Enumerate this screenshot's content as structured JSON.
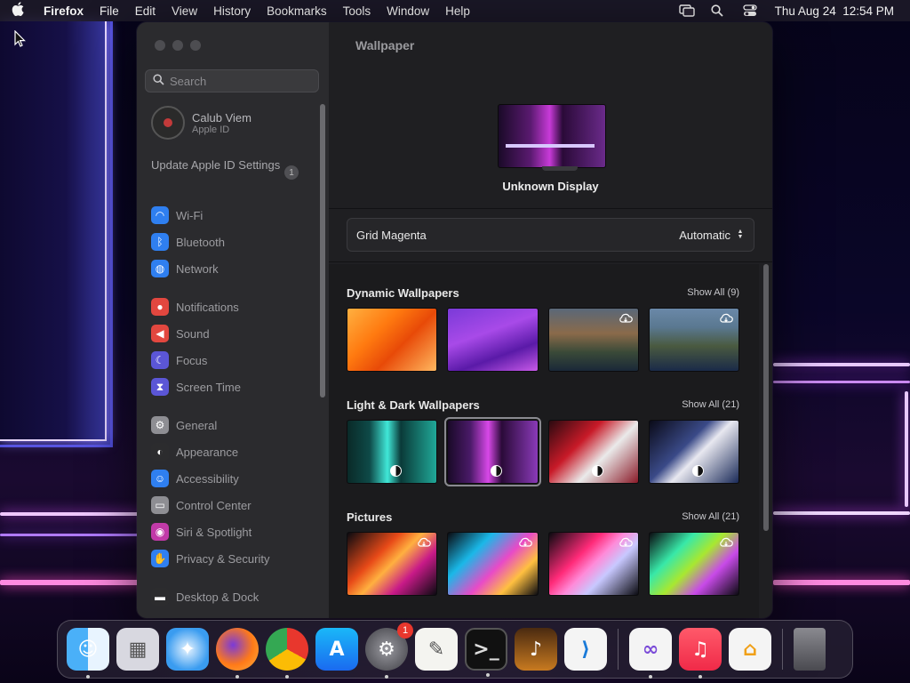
{
  "menubar": {
    "app": "Firefox",
    "items": [
      "File",
      "Edit",
      "View",
      "History",
      "Bookmarks",
      "Tools",
      "Window",
      "Help"
    ],
    "clock": "Thu Aug 24  12:54 PM"
  },
  "window": {
    "sidebar": {
      "search_placeholder": "Search",
      "profile": {
        "name": "Calub Viem",
        "sub": "Apple ID"
      },
      "update": {
        "label": "Update Apple ID Settings",
        "count": "1"
      },
      "items": [
        {
          "label": "Wi-Fi",
          "icon": "wifi-icon",
          "color": "#2f7ff0"
        },
        {
          "label": "Bluetooth",
          "icon": "bluetooth-icon",
          "color": "#2f7ff0"
        },
        {
          "label": "Network",
          "icon": "globe-icon",
          "color": "#2f7ff0"
        },
        {
          "label": "Notifications",
          "icon": "bell-icon",
          "color": "#e2473f"
        },
        {
          "label": "Sound",
          "icon": "speaker-icon",
          "color": "#e2473f"
        },
        {
          "label": "Focus",
          "icon": "moon-icon",
          "color": "#5b56d6"
        },
        {
          "label": "Screen Time",
          "icon": "hourglass-icon",
          "color": "#5b56d6"
        },
        {
          "label": "General",
          "icon": "gear-icon",
          "color": "#8e8e93"
        },
        {
          "label": "Appearance",
          "icon": "appearance-icon",
          "color": "#2c2c2e"
        },
        {
          "label": "Accessibility",
          "icon": "accessibility-icon",
          "color": "#2f7ff0"
        },
        {
          "label": "Control Center",
          "icon": "control-center-icon",
          "color": "#8e8e93"
        },
        {
          "label": "Siri & Spotlight",
          "icon": "siri-icon",
          "color": "#c13aa8"
        },
        {
          "label": "Privacy & Security",
          "icon": "hand-icon",
          "color": "#2f7ff0"
        },
        {
          "label": "Desktop & Dock",
          "icon": "dock-icon",
          "color": "#2c2c2e"
        }
      ]
    },
    "main": {
      "title": "Wallpaper",
      "display_name": "Unknown Display",
      "current_wallpaper": "Grid Magenta",
      "mode": "Automatic",
      "sections": [
        {
          "title": "Dynamic Wallpapers",
          "show_all": "Show All (9)"
        },
        {
          "title": "Light & Dark Wallpapers",
          "show_all": "Show All (21)"
        },
        {
          "title": "Pictures",
          "show_all": "Show All (21)"
        }
      ]
    }
  },
  "dock": {
    "apps": [
      {
        "name": "Finder",
        "icon": "finder-icon",
        "running": true
      },
      {
        "name": "Launchpad",
        "icon": "launchpad-icon",
        "running": false
      },
      {
        "name": "Safari",
        "icon": "safari-icon",
        "running": false
      },
      {
        "name": "Firefox",
        "icon": "firefox-icon",
        "running": true
      },
      {
        "name": "Chrome",
        "icon": "chrome-icon",
        "running": true
      },
      {
        "name": "App Store",
        "icon": "app-store-icon",
        "running": false
      },
      {
        "name": "System Settings",
        "icon": "system-settings-icon",
        "running": true,
        "badge": "1"
      },
      {
        "name": "TextEdit",
        "icon": "textedit-icon",
        "running": false
      },
      {
        "name": "Terminal",
        "icon": "terminal-icon",
        "running": true
      },
      {
        "name": "GarageBand",
        "icon": "garageband-icon",
        "running": false
      },
      {
        "name": "VS Code",
        "icon": "vscode-icon",
        "running": false
      },
      {
        "name": "Visual Studio",
        "icon": "visual-studio-icon",
        "running": true
      },
      {
        "name": "Music",
        "icon": "music-icon",
        "running": true
      },
      {
        "name": "Home",
        "icon": "home-icon",
        "running": false
      },
      {
        "name": "Trash",
        "icon": "trash-icon",
        "running": false
      }
    ]
  }
}
